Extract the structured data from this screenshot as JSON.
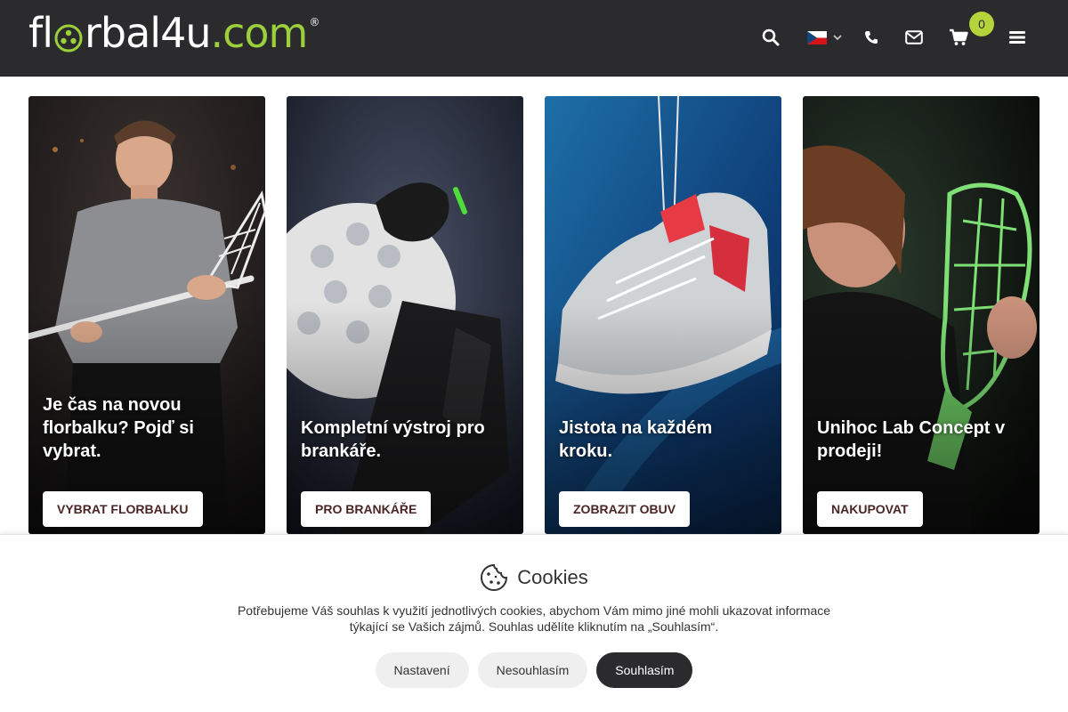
{
  "header": {
    "logo": {
      "part1": "fl",
      "part2": "rbal4u",
      "part3": ".com",
      "reg": "®"
    },
    "cart_count": "0",
    "icons": [
      "search-icon",
      "flag-cz-icon",
      "chevron-down-icon",
      "phone-icon",
      "mail-icon",
      "cart-icon",
      "menu-icon"
    ],
    "colors": {
      "bar": "#2b2b2d",
      "accent": "#9ccf3c",
      "badge": "#b5d33a"
    }
  },
  "cards": [
    {
      "title": "Je čas na novou florbalku? Pojď si vybrat.",
      "button": "VYBRAT FLORBALKU"
    },
    {
      "title": "Kompletní výstroj pro brankáře.",
      "button": "PRO BRANKÁŘE"
    },
    {
      "title": "Jistota na každém kroku.",
      "button": "ZOBRAZIT OBUV"
    },
    {
      "title": "Unihoc Lab Concept v prodeji!",
      "button": "NAKUPOVAT"
    }
  ],
  "cookie": {
    "title": "Cookies",
    "text": "Potřebujeme Váš souhlas k využití jednotlivých cookies, abychom Vám mimo jiné mohli ukazovat informace týkající se Vašich zájmů. Souhlas udělíte kliknutím na „Souhlasím“.",
    "settings": "Nastavení",
    "reject": "Nesouhlasím",
    "accept": "Souhlasím"
  }
}
